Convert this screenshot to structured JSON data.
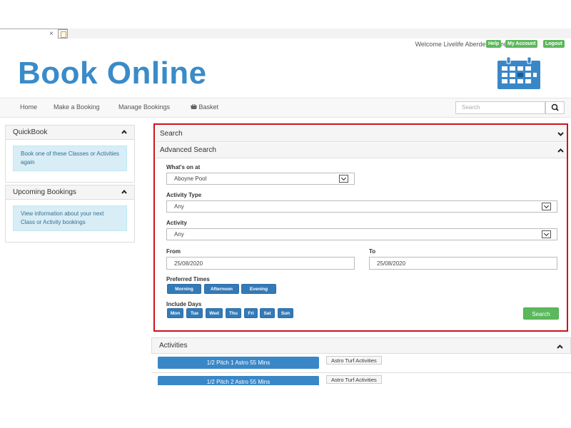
{
  "browser": {
    "tab_close": "×"
  },
  "header": {
    "welcome": "Welcome Livelife Aberdeenshire",
    "help": "Help",
    "my_account": "My Account",
    "logout": "Logout",
    "title": "Book Online"
  },
  "nav": {
    "home": "Home",
    "make_booking": "Make a Booking",
    "manage_bookings": "Manage Bookings",
    "basket": "Basket",
    "search_placeholder": "Search"
  },
  "sidebar": {
    "quickbook": {
      "title": "QuickBook",
      "info": "Book one of these Classes or Activities again"
    },
    "upcoming": {
      "title": "Upcoming Bookings",
      "info": "View information about your next Class or Activity bookings"
    }
  },
  "search": {
    "section_title": "Search",
    "advanced_title": "Advanced Search",
    "whats_on_label": "What's on at",
    "whats_on_value": "Aboyne Pool",
    "activity_type_label": "Activity Type",
    "activity_type_value": "Any",
    "activity_label": "Activity",
    "activity_value": "Any",
    "from_label": "From",
    "from_value": "25/08/2020",
    "to_label": "To",
    "to_value": "25/08/2020",
    "preferred_times_label": "Preferred Times",
    "times": [
      "Morning",
      "Afternoon",
      "Evening"
    ],
    "include_days_label": "Include Days",
    "days": [
      "Mon",
      "Tue",
      "Wed",
      "Thu",
      "Fri",
      "Sat",
      "Sun"
    ],
    "search_button": "Search"
  },
  "activities": {
    "title": "Activities",
    "rows": [
      {
        "name": "1/2 Pitch 1 Astro 55 Mins",
        "tag": "Astro Turf Activities"
      },
      {
        "name": "1/2 Pitch 2 Astro 55 Mins",
        "tag": "Astro Turf Activities"
      }
    ]
  },
  "colors": {
    "brand_blue": "#3a8bc8",
    "button_blue": "#337ab7",
    "green": "#5cb85c",
    "highlight_red": "#c8151c"
  }
}
